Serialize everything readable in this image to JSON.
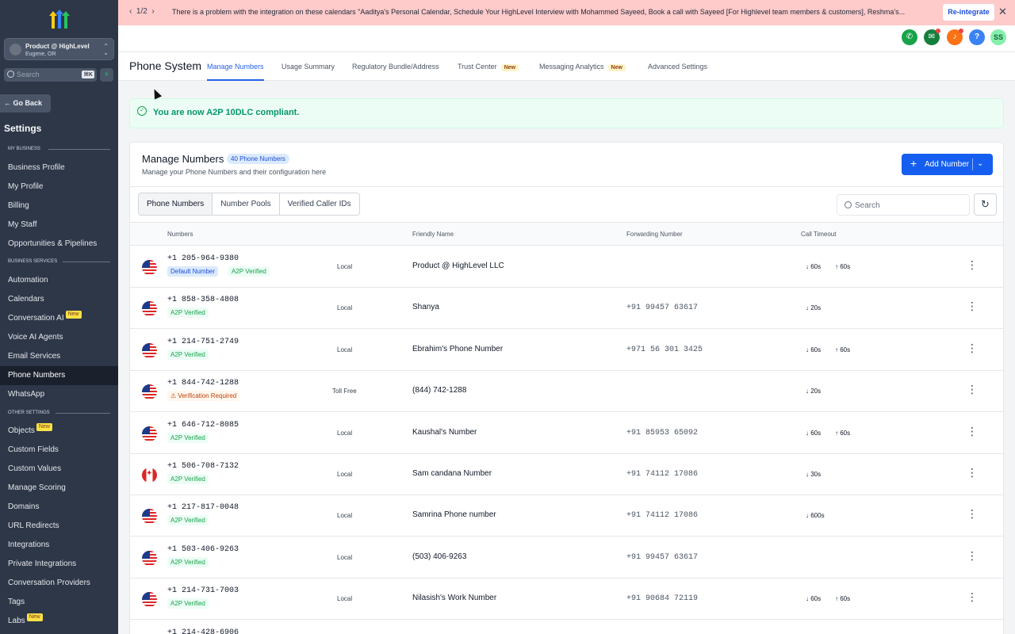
{
  "banner": {
    "pager": "1/2",
    "message": "There is a problem with the integration on these calendars \"Aaditya's Personal Calendar, Schedule Your HighLevel Interview with Mohammed Sayeed, Book a call with Sayeed [For Highlevel team members & customers], Reshma's...",
    "action": "Re-integrate"
  },
  "header": {
    "avatar_initials": "SS",
    "icons": [
      "phone-icon",
      "megaphone-icon",
      "bell-icon",
      "help-icon"
    ]
  },
  "sidebar": {
    "account_name": "Product @ HighLevel",
    "account_location": "Eugene, OR",
    "search_placeholder": "Search",
    "search_shortcut": "⌘K",
    "go_back": "Go Back",
    "title": "Settings",
    "sections": {
      "my_business": "MY BUSINESS",
      "business_services": "BUSINESS SERVICES",
      "other_settings": "OTHER SETTINGS"
    },
    "items": [
      {
        "label": "Business Profile"
      },
      {
        "label": "My Profile"
      },
      {
        "label": "Billing"
      },
      {
        "label": "My Staff"
      },
      {
        "label": "Opportunities & Pipelines"
      },
      {
        "label": "Automation"
      },
      {
        "label": "Calendars"
      },
      {
        "label": "Conversation AI",
        "badge": "New"
      },
      {
        "label": "Voice AI Agents"
      },
      {
        "label": "Email Services"
      },
      {
        "label": "Phone Numbers",
        "active": true
      },
      {
        "label": "WhatsApp"
      },
      {
        "label": "Objects",
        "badge": "New"
      },
      {
        "label": "Custom Fields"
      },
      {
        "label": "Custom Values"
      },
      {
        "label": "Manage Scoring"
      },
      {
        "label": "Domains"
      },
      {
        "label": "URL Redirects"
      },
      {
        "label": "Integrations"
      },
      {
        "label": "Private Integrations"
      },
      {
        "label": "Conversation Providers"
      },
      {
        "label": "Tags"
      },
      {
        "label": "Labs",
        "badge": "New"
      }
    ]
  },
  "page": {
    "title": "Phone System",
    "tabs": [
      {
        "label": "Manage Numbers",
        "active": true
      },
      {
        "label": "Usage Summary"
      },
      {
        "label": "Regulatory Bundle/Address"
      },
      {
        "label": "Trust Center",
        "badge": "New"
      },
      {
        "label": "Messaging Analytics",
        "badge": "New"
      },
      {
        "label": "Advanced Settings"
      }
    ]
  },
  "alert": {
    "text": "You are now A2P 10DLC compliant."
  },
  "card": {
    "title": "Manage Numbers",
    "count": "40 Phone Numbers",
    "subtitle": "Manage your Phone Numbers and their configuration here",
    "add_button": "Add Number",
    "segments": [
      "Phone Numbers",
      "Number Pools",
      "Verified Caller IDs"
    ],
    "search_placeholder": "Search",
    "columns": {
      "numbers": "Numbers",
      "friendly_name": "Friendly Name",
      "forwarding": "Forwarding Number",
      "timeout": "Call Timeout"
    }
  },
  "rows": [
    {
      "flag": "us",
      "number": "+1 205-964-9380",
      "tags": [
        "Default Number",
        "A2P Verified"
      ],
      "type": "Local",
      "name": "Product @ HighLevel LLC",
      "forward": "",
      "in": "60s",
      "out": "60s"
    },
    {
      "flag": "us",
      "number": "+1 858-358-4808",
      "tags": [
        "A2P Verified"
      ],
      "type": "Local",
      "name": "Shanya",
      "forward": "+91 99457 63617",
      "in": "20s",
      "out": ""
    },
    {
      "flag": "us",
      "number": "+1 214-751-2749",
      "tags": [
        "A2P Verified"
      ],
      "type": "Local",
      "name": "Ebrahim's Phone Number",
      "forward": "+971 56 301 3425",
      "in": "60s",
      "out": "60s"
    },
    {
      "flag": "us",
      "number": "+1 844-742-1288",
      "tags": [
        "Verification Required"
      ],
      "type": "Toll Free",
      "name": "(844) 742-1288",
      "forward": "",
      "in": "20s",
      "out": ""
    },
    {
      "flag": "us",
      "number": "+1 646-712-8085",
      "tags": [
        "A2P Verified"
      ],
      "type": "Local",
      "name": "Kaushal's Number",
      "forward": "+91 85953 65092",
      "in": "60s",
      "out": "60s"
    },
    {
      "flag": "ca",
      "number": "+1 506-708-7132",
      "tags": [
        "A2P Verified"
      ],
      "type": "Local",
      "name": "Sam candana Number",
      "forward": "+91 74112 17086",
      "in": "30s",
      "out": ""
    },
    {
      "flag": "us",
      "number": "+1 217-817-0048",
      "tags": [
        "A2P Verified"
      ],
      "type": "Local",
      "name": "Samrina Phone number",
      "forward": "+91 74112 17086",
      "in": "600s",
      "out": ""
    },
    {
      "flag": "us",
      "number": "+1 503-406-9263",
      "tags": [
        "A2P Verified"
      ],
      "type": "Local",
      "name": "(503) 406-9263",
      "forward": "+91 99457 63617",
      "in": "",
      "out": ""
    },
    {
      "flag": "us",
      "number": "+1 214-731-7003",
      "tags": [
        "A2P Verified"
      ],
      "type": "Local",
      "name": "Nilasish's Work Number",
      "forward": "+91 90684 72119",
      "in": "60s",
      "out": "60s"
    },
    {
      "flag": "us",
      "number": "+1 214-428-6906",
      "tags": [],
      "type": "",
      "name": "",
      "forward": "",
      "in": "",
      "out": ""
    }
  ]
}
